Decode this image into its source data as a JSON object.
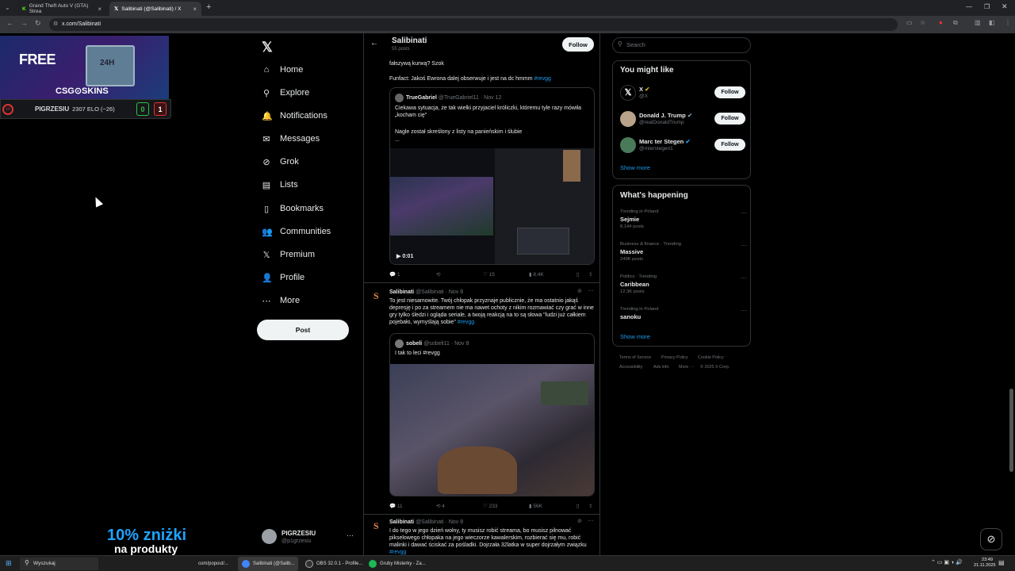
{
  "browser": {
    "tabs": [
      {
        "label": "Grand Theft Auto V (GTA) Strea",
        "active": false
      },
      {
        "label": "Salibinati (@Salibinati) / X",
        "active": true
      }
    ],
    "url": "x.com/Salibinati"
  },
  "overlay": {
    "promo_text": "FREE",
    "promo_brand": "CSG⊙SKINS",
    "box_label": "24H",
    "elo_level": "10",
    "player": "PIGRZESIU",
    "elo": "2307 ELO (−26)",
    "score_left": "0",
    "score_right": "1",
    "discount_line1": "10% zniżki",
    "discount_line2": "na produkty"
  },
  "sidebar": {
    "items": [
      {
        "label": "Home",
        "icon": "⌂"
      },
      {
        "label": "Explore",
        "icon": "⚲"
      },
      {
        "label": "Notifications",
        "icon": "🔔"
      },
      {
        "label": "Messages",
        "icon": "✉"
      },
      {
        "label": "Grok",
        "icon": "⊘"
      },
      {
        "label": "Lists",
        "icon": "▤"
      },
      {
        "label": "Bookmarks",
        "icon": "▯"
      },
      {
        "label": "Communities",
        "icon": "👥"
      },
      {
        "label": "Premium",
        "icon": "𝕏"
      },
      {
        "label": "Profile",
        "icon": "👤"
      },
      {
        "label": "More",
        "icon": "⋯"
      }
    ],
    "post_label": "Post",
    "account_name": "PIGRZESIU",
    "account_handle": "@p1grzesiu"
  },
  "profile_header": {
    "name": "Salibinati",
    "post_count": "55 posts",
    "follow_label": "Follow"
  },
  "feed": {
    "post1": {
      "partial_line": "fałszywą kurwą? Szok",
      "funfact": "Funfact: Jakoś Ewrona dalej obserwuje i jest na dc hmmm",
      "hashtag": "#revgg",
      "quote": {
        "name": "TrueGabriel",
        "handle": "@TrueGabriel11",
        "date": "· Nov 12",
        "text1": "Ciekawa sytuacja, że tak wielki przyjaciel króliczki, któremu tyle razy mówiła „kocham cię\"",
        "text2": "Nagle został skreślony z listy na panieńskim i ślubie",
        "text3": "...",
        "video_time": "0:01"
      },
      "actions": {
        "replies": "1",
        "reposts": "",
        "likes": "15",
        "views": "8.4K"
      }
    },
    "post2": {
      "name": "Salibinati",
      "handle": "@Salibinati",
      "date": "· Nov 8",
      "text": "To jest niesamowite. Twój chłopak przyznaje publicznie, że ma ostatnio jakąś depresję i po za streamem nie ma nawet ochoty z nikim rozmawiać czy grać w inne gry tylko śledzi i ogląda seriale, a twoją reakcją na to są słowa \"ludzi już całkiem pojebało, wymyślają sobie\"",
      "hashtag": "#revgg",
      "quote": {
        "name": "sobeli",
        "handle": "@sobeli11",
        "date": "· Nov 8",
        "text": "I tak to leci #revgg"
      },
      "actions": {
        "replies": "11",
        "reposts": "4",
        "likes": "233",
        "views": "56K"
      }
    },
    "post3": {
      "name": "Salibinati",
      "handle": "@Salibinati",
      "date": "· Nov 8",
      "text": "I do tego w jego dzień wolny, ty musisz robić streama, bo musisz pilnować pikselowego chłopaka na jego wieczorze kawalerskim, rozbierać się mu, robić malinki i dawać ściskać za pośladki. Dojrzała 32latka w super dojrzałym związku",
      "hashtag": "#revgg"
    }
  },
  "right": {
    "search_placeholder": "Search",
    "you_might_like": "You might like",
    "suggestions": [
      {
        "name": "X",
        "handle": "@X",
        "follow": "Follow"
      },
      {
        "name": "Donald J. Trump",
        "handle": "@realDonaldTrump",
        "follow": "Follow"
      },
      {
        "name": "Marc ter Stegen",
        "handle": "@mterstegen1",
        "follow": "Follow"
      }
    ],
    "show_more": "Show more",
    "whats_happening": "What's happening",
    "trends": [
      {
        "context": "Trending in Poland",
        "name": "Sejmie",
        "count": "8,144 posts"
      },
      {
        "context": "Business & finance · Trending",
        "name": "Massive",
        "count": "249K posts"
      },
      {
        "context": "Politics · Trending",
        "name": "Caribbean",
        "count": "12.3K posts"
      },
      {
        "context": "Trending in Poland",
        "name": "sanoku",
        "count": ""
      }
    ],
    "footer": [
      "Terms of Service",
      "Privacy Policy",
      "Cookie Policy",
      "Accessibility",
      "Ads info",
      "More ···",
      "© 2025 X Corp."
    ]
  },
  "taskbar": {
    "search": "Wyszukaj",
    "items": [
      {
        "label": "com/popout/..."
      },
      {
        "label": "Salibinati (@Salib..."
      },
      {
        "label": "OBS 32.0.1 - Profile..."
      },
      {
        "label": "Gruby Misterky - Za..."
      }
    ],
    "time": "23:49",
    "date": "21.11.2025"
  },
  "colors": {
    "accent": "#1d9bf0",
    "bg": "#000000",
    "border": "#2f3336"
  }
}
